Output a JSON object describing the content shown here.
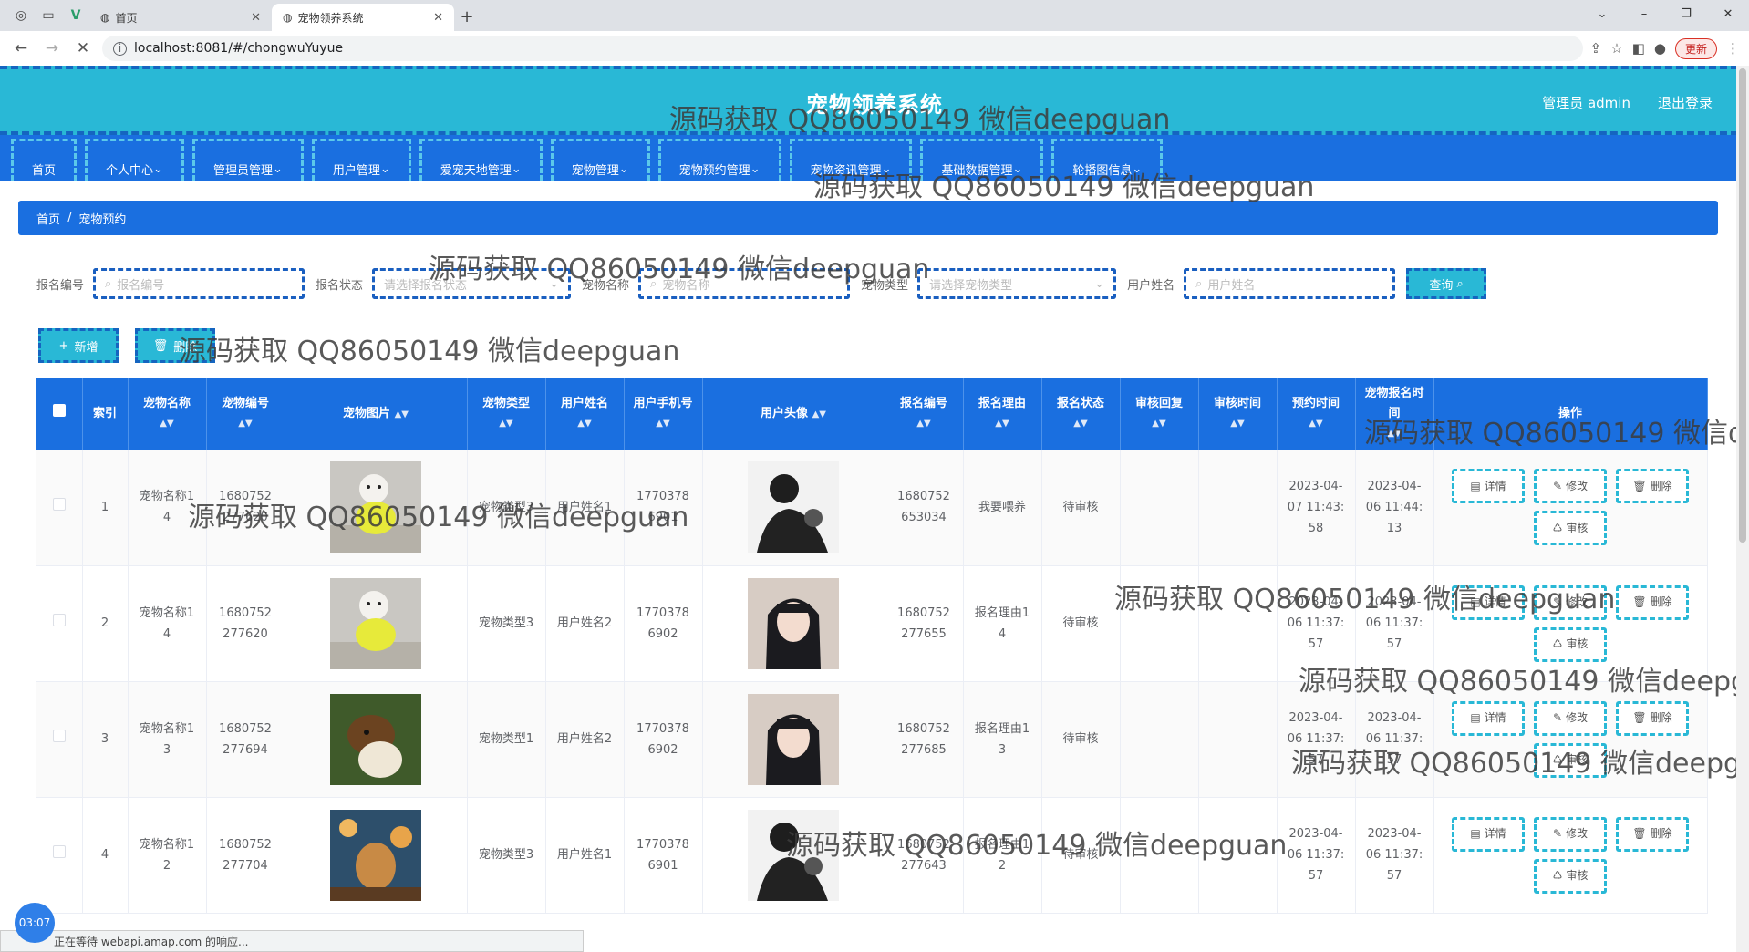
{
  "browser": {
    "tabs": [
      {
        "title": "首页",
        "active": false
      },
      {
        "title": "宠物领养系统",
        "active": true
      }
    ],
    "url": "localhost:8081/#/chongwuYuyue",
    "update_label": "更新",
    "status_text": "正在等待 webapi.amap.com 的响应...",
    "clock": "03:07"
  },
  "header": {
    "title": "宠物领养系统",
    "user_label": "管理员 admin",
    "logout_label": "退出登录"
  },
  "menu": [
    {
      "label": "首页"
    },
    {
      "label": "个人中心"
    },
    {
      "label": "管理员管理"
    },
    {
      "label": "用户管理"
    },
    {
      "label": "爱宠天地管理"
    },
    {
      "label": "宠物管理"
    },
    {
      "label": "宠物预约管理"
    },
    {
      "label": "宠物资讯管理"
    },
    {
      "label": "基础数据管理"
    },
    {
      "label": "轮播图信息"
    }
  ],
  "breadcrumb": {
    "home": "首页",
    "sep": "/",
    "current": "宠物预约"
  },
  "search": {
    "f1_label": "报名编号",
    "f1_placeholder": "报名编号",
    "f2_label": "报名状态",
    "f2_placeholder": "请选择报名状态",
    "f3_label": "宠物名称",
    "f3_placeholder": "宠物名称",
    "f4_label": "宠物类型",
    "f4_placeholder": "请选择宠物类型",
    "f5_label": "用户姓名",
    "f5_placeholder": "用户姓名",
    "query_label": "查询"
  },
  "actions": {
    "add_label": "新增",
    "delete_label": "删除"
  },
  "table": {
    "columns": [
      "索引",
      "宠物名称",
      "宠物编号",
      "宠物图片",
      "宠物类型",
      "用户姓名",
      "用户手机号",
      "用户头像",
      "报名编号",
      "报名理由",
      "报名状态",
      "审核回复",
      "审核时间",
      "预约时间",
      "宠物报名时间",
      "操作"
    ],
    "op_labels": {
      "detail": "详情",
      "edit": "修改",
      "delete": "删除",
      "audit": "审核"
    },
    "rows": [
      {
        "index": "1",
        "pet_name": "宠物名称14",
        "pet_no": "1680752277620",
        "pet_img": "white-dog-photo",
        "pet_type": "宠物类型3",
        "user_name": "用户姓名1",
        "phone": "17703786901",
        "avatar": "man-avatar",
        "apply_no": "1680752653034",
        "reason": "我要喂养",
        "status": "待审核",
        "reply": "",
        "audit_time": "",
        "booking_time": "2023-04-07 11:43:58",
        "apply_time": "2023-04-06 11:44:13"
      },
      {
        "index": "2",
        "pet_name": "宠物名称14",
        "pet_no": "1680752277620",
        "pet_img": "white-dog-photo",
        "pet_type": "宠物类型3",
        "user_name": "用户姓名2",
        "phone": "17703786902",
        "avatar": "girl-avatar",
        "apply_no": "1680752277655",
        "reason": "报名理由14",
        "status": "待审核",
        "reply": "",
        "audit_time": "",
        "booking_time": "2023-04-06 11:37:57",
        "apply_time": "2023-04-06 11:37:57"
      },
      {
        "index": "3",
        "pet_name": "宠物名称13",
        "pet_no": "1680752277694",
        "pet_img": "collie-dog-photo",
        "pet_type": "宠物类型1",
        "user_name": "用户姓名2",
        "phone": "17703786902",
        "avatar": "girl-avatar",
        "apply_no": "1680752277685",
        "reason": "报名理由13",
        "status": "待审核",
        "reply": "",
        "audit_time": "",
        "booking_time": "2023-04-06 11:37:57",
        "apply_time": "2023-04-06 11:37:57"
      },
      {
        "index": "4",
        "pet_name": "宠物名称12",
        "pet_no": "1680752277704",
        "pet_img": "golden-dog-photo",
        "pet_type": "宠物类型3",
        "user_name": "用户姓名1",
        "phone": "17703786901",
        "avatar": "man-avatar",
        "apply_no": "1680752277643",
        "reason": "报名理由12",
        "status": "待审核",
        "reply": "",
        "audit_time": "",
        "booking_time": "2023-04-06 11:37:57",
        "apply_time": "2023-04-06 11:37:57"
      }
    ]
  },
  "watermark": "源码获取 QQ86050149 微信deepguan"
}
